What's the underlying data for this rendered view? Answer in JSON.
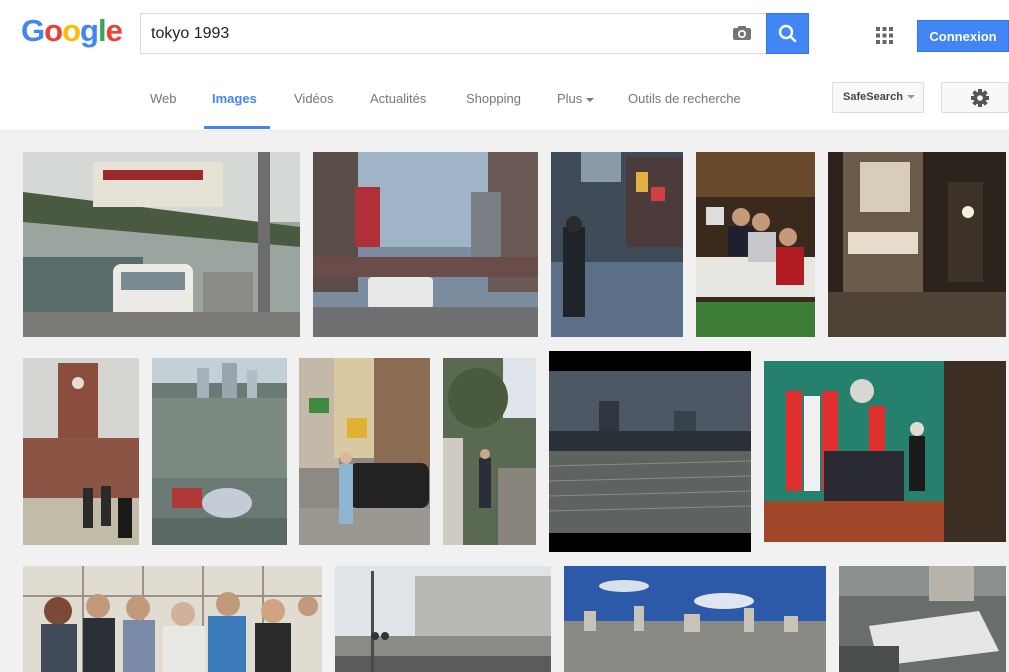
{
  "header": {
    "logo_letters": [
      "G",
      "o",
      "o",
      "g",
      "l",
      "e"
    ],
    "logo_colors": [
      "#4285f4",
      "#ea4335",
      "#fbbc05",
      "#4285f4",
      "#34a853",
      "#ea4335"
    ],
    "search_value": "tokyo 1993",
    "camera_icon": "camera-icon",
    "search_icon": "search-icon",
    "apps_icon": "apps-grid-icon",
    "signin_label": "Connexion"
  },
  "tabs": {
    "items": [
      {
        "label": "Web"
      },
      {
        "label": "Images"
      },
      {
        "label": "Vidéos"
      },
      {
        "label": "Actualités"
      },
      {
        "label": "Shopping"
      },
      {
        "label": "Plus"
      },
      {
        "label": "Outils de recherche"
      }
    ],
    "active": "Images",
    "safesearch_label": "SafeSearch",
    "settings_icon": "gear-icon"
  },
  "colors": {
    "accent": "#4285f4"
  },
  "results": {
    "images": [
      {
        "subject": "Tokyo monorail over street with white vans"
      },
      {
        "subject": "Wide city street with overpass and billboards"
      },
      {
        "subject": "Rainy street with woman walking and neon signs"
      },
      {
        "subject": "Three people seated at a table with laptops"
      },
      {
        "subject": "Sepia night street with large signboards"
      },
      {
        "subject": "University of Tokyo Yasuda Auditorium clock tower"
      },
      {
        "subject": "Aerial view of Tokyo with stadium"
      },
      {
        "subject": "Woman standing on busy Tokyo street"
      },
      {
        "subject": "Man standing on path by trees"
      },
      {
        "subject": "Rail yard at dusk with skyline"
      },
      {
        "subject": "Press conference with Canadian flags"
      },
      {
        "subject": "Group of people posing indoors"
      },
      {
        "subject": "Modern building facade with street lamp"
      },
      {
        "subject": "Tokyo skyline under blue sky"
      },
      {
        "subject": "Damaged boat among houses"
      }
    ]
  }
}
